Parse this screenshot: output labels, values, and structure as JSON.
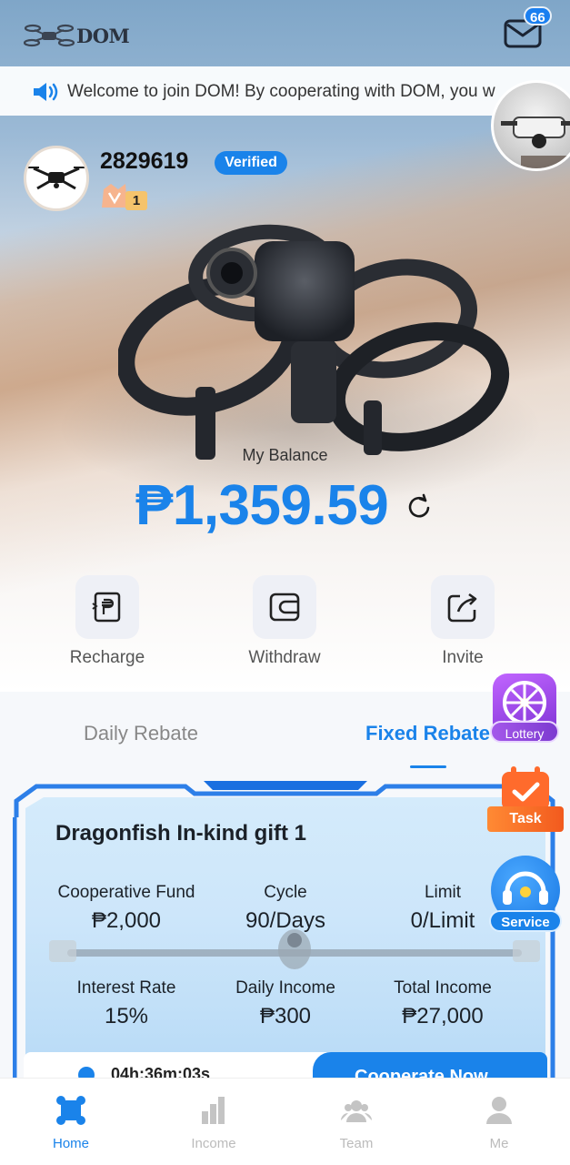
{
  "header": {
    "logo_text": "DOM",
    "mail_count": "66"
  },
  "notice": {
    "text": "Welcome to join DOM! By cooperating with DOM, you w"
  },
  "profile": {
    "user_id": "2829619",
    "verified_label": "Verified",
    "vip_level": "1"
  },
  "balance": {
    "label": "My Balance",
    "amount": "₱1,359.59"
  },
  "actions": [
    {
      "label": "Recharge",
      "icon": "recharge-icon"
    },
    {
      "label": "Withdraw",
      "icon": "wallet-icon"
    },
    {
      "label": "Invite",
      "icon": "share-icon"
    }
  ],
  "tabs": {
    "daily": "Daily Rebate",
    "fixed": "Fixed Rebate",
    "active": "fixed"
  },
  "card": {
    "title": "Dragonfish In-kind gift 1",
    "stats": [
      {
        "key": "Cooperative Fund",
        "value": "₱2,000"
      },
      {
        "key": "Cycle",
        "value": "90/Days"
      },
      {
        "key": "Limit",
        "value": "0/Limit"
      },
      {
        "key": "Interest Rate",
        "value": "15%"
      },
      {
        "key": "Daily Income",
        "value": "₱300"
      },
      {
        "key": "Total Income",
        "value": "₱27,000"
      }
    ],
    "countdown": "04h:36m:03s",
    "button": "Cooperate Now"
  },
  "widgets": {
    "lottery": "Lottery",
    "task": "Task",
    "service": "Service"
  },
  "nav": [
    {
      "label": "Home",
      "icon": "home-icon",
      "active": true
    },
    {
      "label": "Income",
      "icon": "bar-chart-icon",
      "active": false
    },
    {
      "label": "Team",
      "icon": "team-icon",
      "active": false
    },
    {
      "label": "Me",
      "icon": "user-icon",
      "active": false
    }
  ],
  "colors": {
    "accent": "#1a83ea",
    "inactive": "#bbbbbb"
  }
}
